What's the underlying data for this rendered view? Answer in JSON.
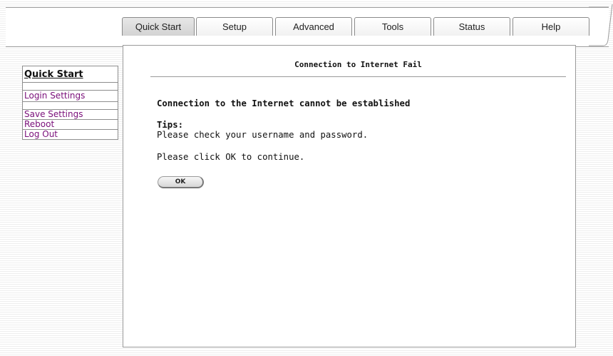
{
  "nav": {
    "tabs": [
      {
        "label": "Quick Start",
        "active": true
      },
      {
        "label": "Setup"
      },
      {
        "label": "Advanced"
      },
      {
        "label": "Tools"
      },
      {
        "label": "Status"
      },
      {
        "label": "Help"
      }
    ]
  },
  "sidebar": {
    "heading": "Quick Start",
    "items": [
      {
        "label": "Login Settings"
      },
      {
        "label": "Save Settings"
      },
      {
        "label": "Reboot"
      },
      {
        "label": "Log Out"
      }
    ]
  },
  "main": {
    "title": "Connection to Internet Fail",
    "heading": "Connection to the Internet cannot be established",
    "tips_label": "Tips:",
    "tips_text": "Please check your username and password.",
    "continue_text": "Please click OK to continue.",
    "ok_label": "OK"
  },
  "colors": {
    "link": "#7a0f7a",
    "border": "#9a9a9a",
    "background_stripe": "#eeeeee"
  }
}
